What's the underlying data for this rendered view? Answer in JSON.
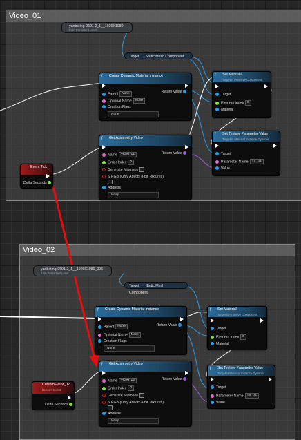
{
  "comment1": {
    "title": "Video_01"
  },
  "comment2": {
    "title": "Video_02"
  },
  "level_actor_1": {
    "label": "yanboting-0601-2_1__1920X1080",
    "sub": "from Persistent Level"
  },
  "level_actor_2": {
    "label": "yanboting-0601-2_1__1920X1080_006",
    "sub": "from Persistent Level"
  },
  "get_component": {
    "target": "Target",
    "label": "Static Mesh Component"
  },
  "create_dmi": {
    "title": "Create Dynamic Material Instance",
    "parent": "Parent",
    "parent_value": "None",
    "optional_name": "Optional Name",
    "optional_value": "None",
    "return_value": "Return Value",
    "creation_flags": "Creation Flags",
    "flags_value": "None"
  },
  "set_material": {
    "title": "Set Material",
    "sub": "Target is Primitive Component",
    "target": "Target",
    "element_index": "Element Index",
    "element_value": "0",
    "material": "Material"
  },
  "get_video": {
    "title": "Get Aximmetry Video",
    "name": "Name",
    "name_value_1": "Video_01",
    "name_value_2": "Video_02",
    "order_index": "Order Index",
    "order_value": "0",
    "return_value": "Return Value",
    "generate_mipmaps": "Generate Mipmaps",
    "srgb": "S RGB (Only Affects 8-bit Textures)",
    "address": "Address",
    "address_value": "Wrap"
  },
  "set_tex": {
    "title": "Set Texture Parameter Value",
    "sub": "Target is Material Instance Dynamic",
    "target": "Target",
    "param_name": "Parameter Name",
    "param_value_1": "TV_01",
    "param_value_2": "TV_02",
    "value": "Value"
  },
  "event_tick": {
    "title": "Event Tick",
    "delta": "Delta Seconds"
  },
  "custom_event": {
    "title": "CustomEvent_02",
    "sub": "Custom Event",
    "delta": "Delta Seconds"
  }
}
